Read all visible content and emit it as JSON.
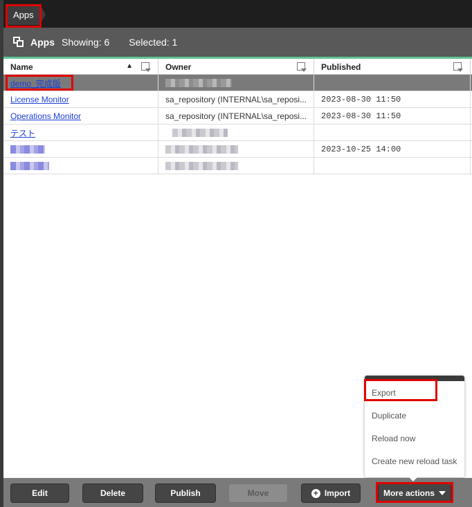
{
  "breadcrumb": {
    "label": "Apps"
  },
  "header": {
    "title": "Apps",
    "showing": "Showing: 6",
    "selected": "Selected: 1"
  },
  "table": {
    "columns": [
      {
        "label": "Name"
      },
      {
        "label": "Owner"
      },
      {
        "label": "Published"
      }
    ],
    "rows": [
      {
        "name": "demo_完成版",
        "owner": "",
        "published": ""
      },
      {
        "name": "License Monitor",
        "owner": "sa_repository (INTERNAL\\sa_reposi...",
        "published": "2023-08-30 11:50"
      },
      {
        "name": "Operations Monitor",
        "owner": "sa_repository (INTERNAL\\sa_reposi...",
        "published": "2023-08-30 11:50"
      },
      {
        "name": "テスト",
        "owner": "",
        "published": ""
      },
      {
        "name": "",
        "owner": "",
        "published": "2023-10-25 14:00"
      },
      {
        "name": "",
        "owner": "",
        "published": ""
      }
    ]
  },
  "menu": {
    "items": [
      {
        "label": "Export"
      },
      {
        "label": "Duplicate"
      },
      {
        "label": "Reload now"
      },
      {
        "label": "Create new reload task"
      }
    ]
  },
  "toolbar": {
    "edit": "Edit",
    "delete": "Delete",
    "publish": "Publish",
    "move": "Move",
    "import": "Import",
    "more_actions": "More actions"
  },
  "colors": {
    "accent": "#5fc595",
    "highlight": "#e00000",
    "link": "#1a3fd6"
  },
  "icons": {
    "header": "apps-icon",
    "sort": "sort-ascending-icon",
    "filter": "filter-icon",
    "import": "plus-circle-icon",
    "more": "caret-down-icon"
  }
}
